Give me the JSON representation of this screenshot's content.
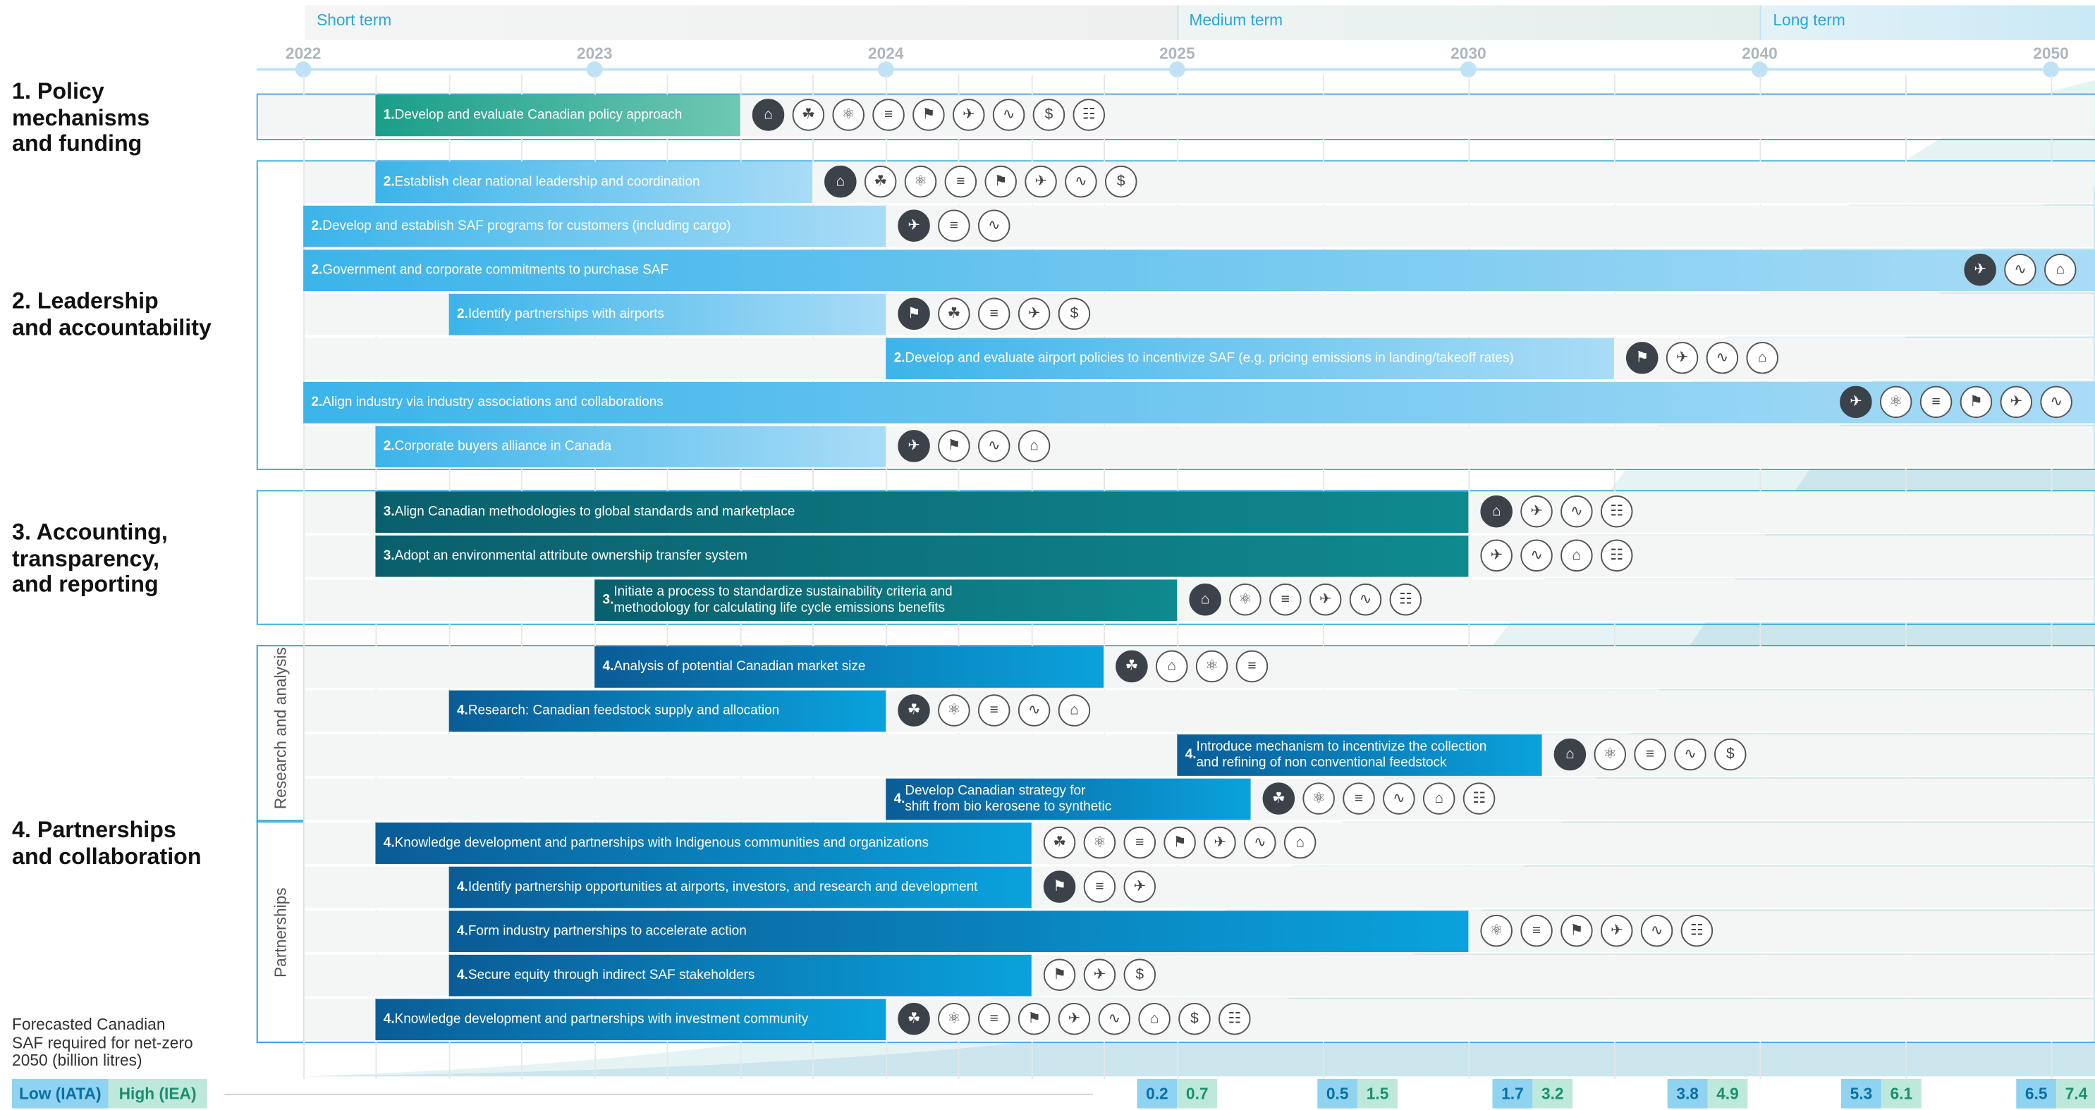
{
  "terms": [
    {
      "label": "Short term"
    },
    {
      "label": "Medium term"
    },
    {
      "label": "Long term"
    }
  ],
  "years": [
    "2022",
    "2023",
    "2024",
    "2025",
    "2030",
    "2040",
    "2050"
  ],
  "categories": [
    {
      "label": "1. Policy\nmechanisms\nand funding"
    },
    {
      "label": "2. Leadership\nand accountability"
    },
    {
      "label": "3. Accounting,\ntransparency,\nand reporting"
    },
    {
      "label": "4. Partnerships\nand collaboration"
    }
  ],
  "sublabels": {
    "research": "Research and analysis",
    "partnerships": "Partnerships"
  },
  "rows": [
    {
      "num": "1.",
      "text": "   Develop and evaluate Canadian policy approach",
      "icons": [
        "building-icon",
        "hand-leaf-icon",
        "atom-icon",
        "document-icon",
        "flag-icon",
        "plane-icon",
        "community-icon",
        "money-hand-icon",
        "clipboard-icon"
      ],
      "dark": 0
    },
    {
      "num": "2.",
      "text": " Establish clear national leadership and coordination",
      "icons": [
        "building-icon",
        "hand-leaf-icon",
        "atom-icon",
        "document-icon",
        "flag-icon",
        "plane-icon",
        "community-icon",
        "money-hand-icon"
      ],
      "dark": 0
    },
    {
      "num": "2.",
      "text": " Develop and establish SAF programs for customers (including cargo)",
      "icons": [
        "plane-icon",
        "document-icon",
        "community-icon"
      ],
      "dark": 0
    },
    {
      "num": "2.",
      "text": " Government and corporate commitments to purchase SAF",
      "icons": [
        "plane-icon",
        "community-icon",
        "building-icon"
      ],
      "dark": 0
    },
    {
      "num": "2.",
      "text": " Identify partnerships with airports",
      "icons": [
        "flag-icon",
        "hand-leaf-icon",
        "document-icon",
        "plane-icon",
        "money-hand-icon"
      ],
      "dark": 0
    },
    {
      "num": "2.",
      "text": " Develop and evaluate airport policies to incentivize SAF (e.g. pricing emissions in landing/takeoff rates)",
      "icons": [
        "flag-icon",
        "plane-icon",
        "community-icon",
        "building-icon"
      ],
      "dark": 0
    },
    {
      "num": "2.",
      "text": " Align industry via industry associations and collaborations",
      "icons": [
        "plane-icon",
        "atom-icon",
        "document-icon",
        "flag-icon",
        "plane-icon",
        "community-icon"
      ],
      "dark": 0
    },
    {
      "num": "2.",
      "text": " Corporate buyers alliance in Canada",
      "icons": [
        "plane-icon",
        "flag-icon",
        "community-icon",
        "building-icon"
      ],
      "dark": 0
    },
    {
      "num": "3.",
      "text": " Align Canadian methodologies to global standards and marketplace",
      "icons": [
        "building-icon",
        "plane-icon",
        "community-icon",
        "clipboard-icon"
      ],
      "dark": 0
    },
    {
      "num": "3.",
      "text": " Adopt an environmental attribute ownership transfer system",
      "icons": [
        "plane-icon",
        "community-icon",
        "building-icon",
        "clipboard-icon"
      ],
      "dark": -1
    },
    {
      "num": "3.",
      "text": " Initiate a process to standardize sustainability criteria and\n     methodology for calculating life cycle emissions benefits",
      "icons": [
        "building-icon",
        "atom-icon",
        "document-icon",
        "plane-icon",
        "community-icon",
        "clipboard-icon"
      ],
      "dark": 0
    },
    {
      "num": "4.",
      "text": " Analysis of potential Canadian market size",
      "icons": [
        "hand-leaf-icon",
        "building-icon",
        "atom-icon",
        "document-icon"
      ],
      "dark": 0
    },
    {
      "num": "4.",
      "text": " Research: Canadian feedstock supply and allocation",
      "icons": [
        "hand-leaf-icon",
        "atom-icon",
        "document-icon",
        "community-icon",
        "building-icon"
      ],
      "dark": 0
    },
    {
      "num": "4.",
      "text": " Introduce mechanism to incentivize the collection\n     and refining of non conventional feedstock",
      "icons": [
        "building-icon",
        "atom-icon",
        "document-icon",
        "community-icon",
        "money-hand-icon"
      ],
      "dark": 0
    },
    {
      "num": "4.",
      "text": " Develop Canadian strategy for\n     shift from bio kerosene to synthetic",
      "icons": [
        "hand-leaf-icon",
        "atom-icon",
        "document-icon",
        "community-icon",
        "building-icon",
        "clipboard-icon"
      ],
      "dark": 0
    },
    {
      "num": "4.",
      "text": " Knowledge development and partnerships with Indigenous communities and organizations",
      "icons": [
        "hand-leaf-icon",
        "atom-icon",
        "document-icon",
        "flag-icon",
        "plane-icon",
        "community-icon",
        "building-icon"
      ],
      "dark": -1
    },
    {
      "num": "4.",
      "text": " Identify partnership opportunities at airports, investors, and research and development",
      "icons": [
        "flag-icon",
        "document-icon",
        "plane-icon"
      ],
      "dark": 0
    },
    {
      "num": "4.",
      "text": " Form industry partnerships to accelerate action",
      "icons": [
        "atom-icon",
        "document-icon",
        "flag-icon",
        "plane-icon",
        "community-icon",
        "clipboard-icon"
      ],
      "dark": -1
    },
    {
      "num": "4.",
      "text": " Secure equity through indirect SAF stakeholders",
      "icons": [
        "flag-icon",
        "plane-icon",
        "money-hand-icon"
      ],
      "dark": -1
    },
    {
      "num": "4.",
      "text": " Knowledge development and partnerships with investment community",
      "icons": [
        "hand-leaf-icon",
        "atom-icon",
        "document-icon",
        "flag-icon",
        "plane-icon",
        "community-icon",
        "building-icon",
        "money-hand-icon",
        "clipboard-icon"
      ],
      "dark": 0
    }
  ],
  "forecast": {
    "label": "Forecasted Canadian\nSAF required for net-zero\n2050 (billion litres)",
    "legend_low": "Low (IATA)",
    "legend_high": "High (IEA)",
    "low_color": "#8fd3f0",
    "high_color": "#bfe8dc",
    "pairs": [
      {
        "low": "0.2",
        "high": "0.7"
      },
      {
        "low": "0.5",
        "high": "1.5"
      },
      {
        "low": "1.7",
        "high": "3.2"
      },
      {
        "low": "3.8",
        "high": "4.9"
      },
      {
        "low": "5.3",
        "high": "6.1"
      },
      {
        "low": "6.5",
        "high": "7.4"
      }
    ]
  },
  "colors": {
    "cat1": "#1fa98a",
    "cat2": "#3cb4ea",
    "cat3": "#0c7d84",
    "cat4": "#0c6fae",
    "accent": "#2aa6d6"
  }
}
